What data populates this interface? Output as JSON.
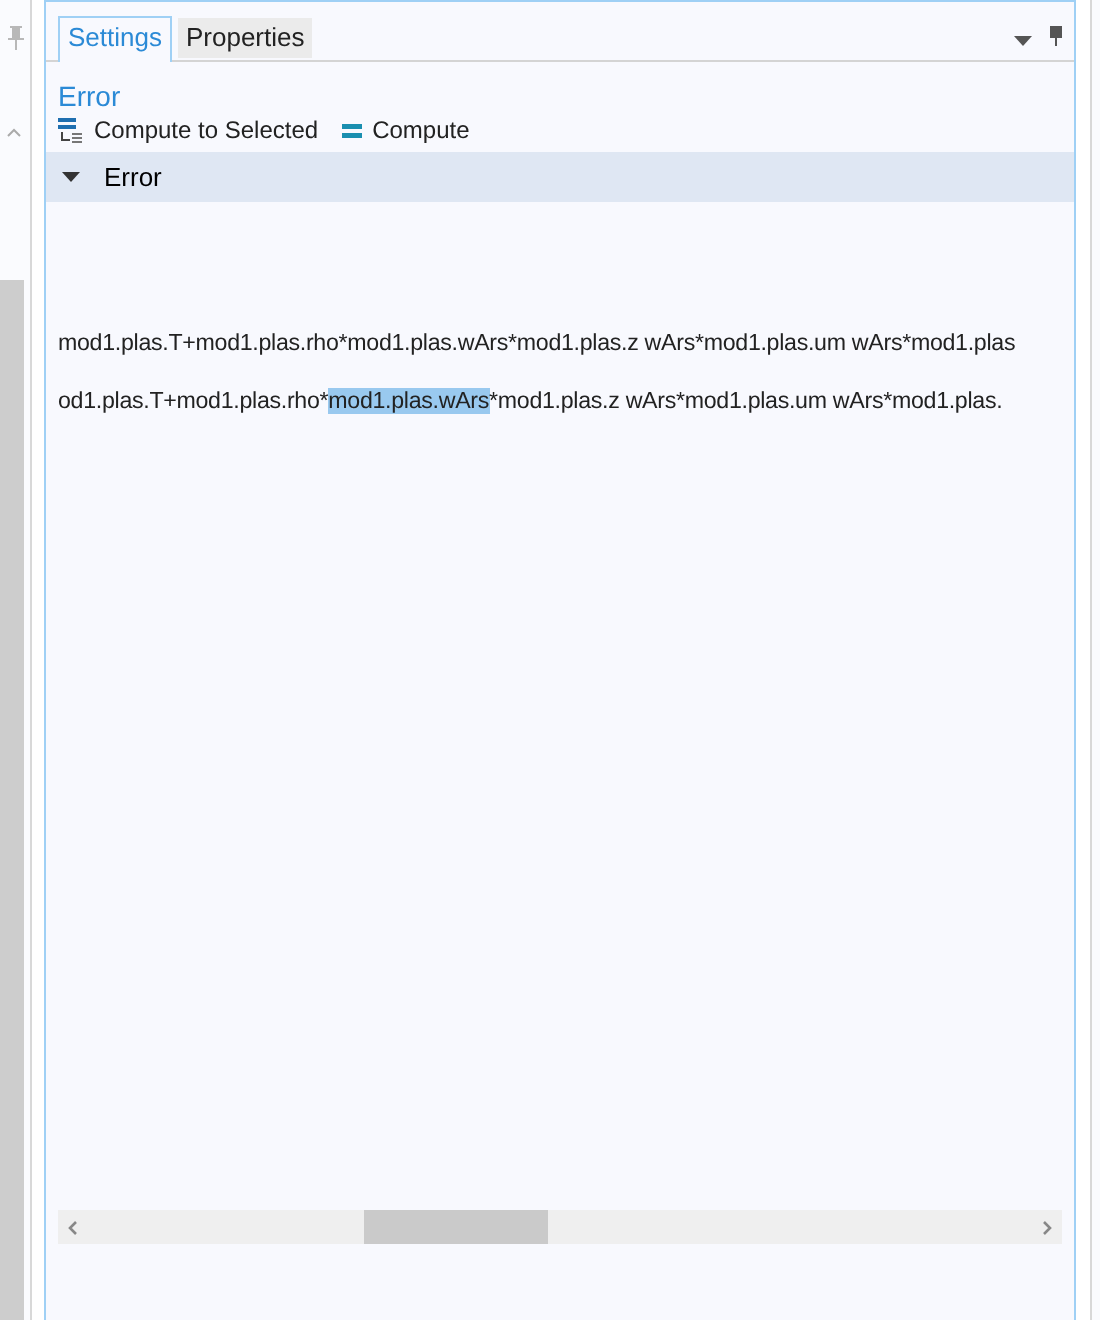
{
  "tabs": [
    {
      "label": "Settings",
      "selected": true
    },
    {
      "label": "Properties",
      "selected": false
    }
  ],
  "title": "Error",
  "toolbar": [
    {
      "kind": "compute-selected",
      "label": "Compute to Selected"
    },
    {
      "kind": "compute",
      "label": "Compute"
    }
  ],
  "section": {
    "label": "Error",
    "expanded": true
  },
  "lines": [
    [
      {
        "text": "mod1.plas.T+mod1.plas.rho*mod1.plas.wArs*mod1.plas.z wArs*mod1.plas.um wArs*mod1.plas",
        "selected": false
      }
    ],
    [
      {
        "text": "od1.plas.T+mod1.plas.rho*",
        "selected": false
      },
      {
        "text": "mod1.plas.wArs",
        "selected": true
      },
      {
        "text": "*mod1.plas.z wArs*mod1.plas.um wArs*mod1.plas.",
        "selected": false
      }
    ]
  ]
}
